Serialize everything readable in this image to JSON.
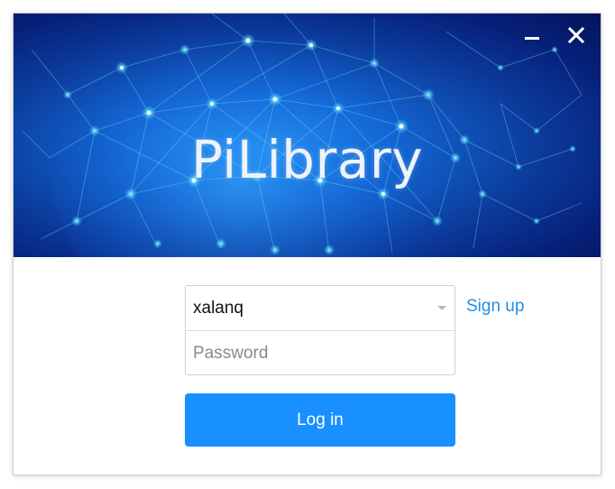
{
  "app": {
    "title": "PiLibrary"
  },
  "window_controls": {
    "minimize_icon": "minimize-icon",
    "close_icon": "close-icon"
  },
  "form": {
    "username_value": "xalanq",
    "password_placeholder": "Password",
    "signup_label": "Sign up",
    "login_label": "Log in"
  },
  "colors": {
    "primary": "#1890ff",
    "link": "#1f8fe6",
    "banner_dark": "#041459",
    "banner_light": "#1f8cf0"
  }
}
